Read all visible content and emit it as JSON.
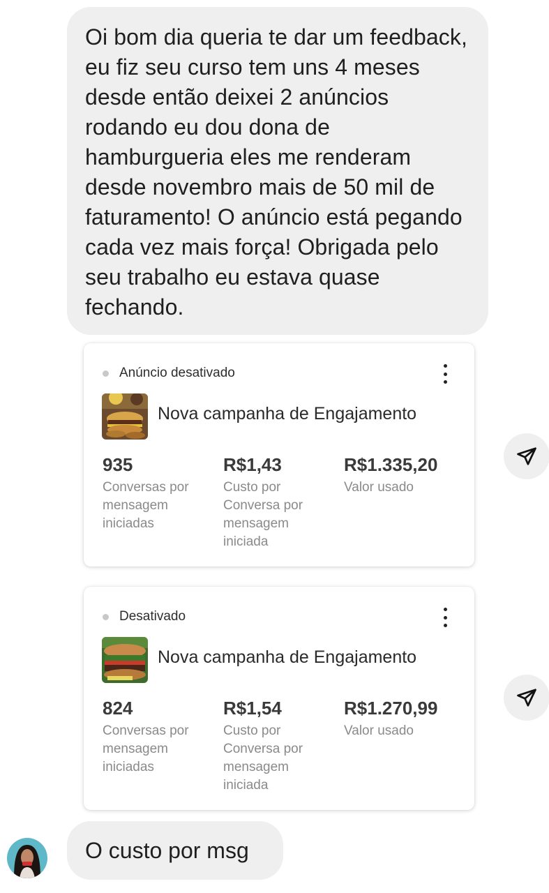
{
  "messages": {
    "incoming_text": "Oi bom dia queria te dar um feedback, eu fiz seu curso tem uns 4 meses desde então deixei 2 anúncios rodando eu dou dona de hamburgueria eles me renderam desde novembro mais de 50 mil de faturamento! O anúncio está pegando cada vez mais força! Obrigada pelo seu trabalho eu estava quase fechando.",
    "last_text": "O custo por msg"
  },
  "cards": [
    {
      "status": "Anúncio desativado",
      "campaign": "Nova campanha de Engajamento",
      "thumbnail_icon": "burger-photo-icon",
      "metrics": [
        {
          "value": "935",
          "label": "Conversas por mensagem iniciadas"
        },
        {
          "value": "R$1,43",
          "label": "Custo por Conversa por mensagem iniciada"
        },
        {
          "value": "R$1.335,20",
          "label": "Valor usado"
        }
      ]
    },
    {
      "status": "Desativado",
      "campaign": "Nova campanha de Engajamento",
      "thumbnail_icon": "burger-photo-icon",
      "metrics": [
        {
          "value": "824",
          "label": "Conversas por mensagem iniciadas"
        },
        {
          "value": "R$1,54",
          "label": "Custo por Conversa por mensagem iniciada"
        },
        {
          "value": "R$1.270,99",
          "label": "Valor usado"
        }
      ]
    }
  ],
  "icons": {
    "share": "send-icon",
    "more": "more-vertical-icon"
  },
  "colors": {
    "bubble_bg": "#efefef",
    "card_bg": "#ffffff",
    "metric_value": "#3a3a3a",
    "metric_label": "#8a8a8a",
    "status_dot": "#c8c8c8"
  }
}
